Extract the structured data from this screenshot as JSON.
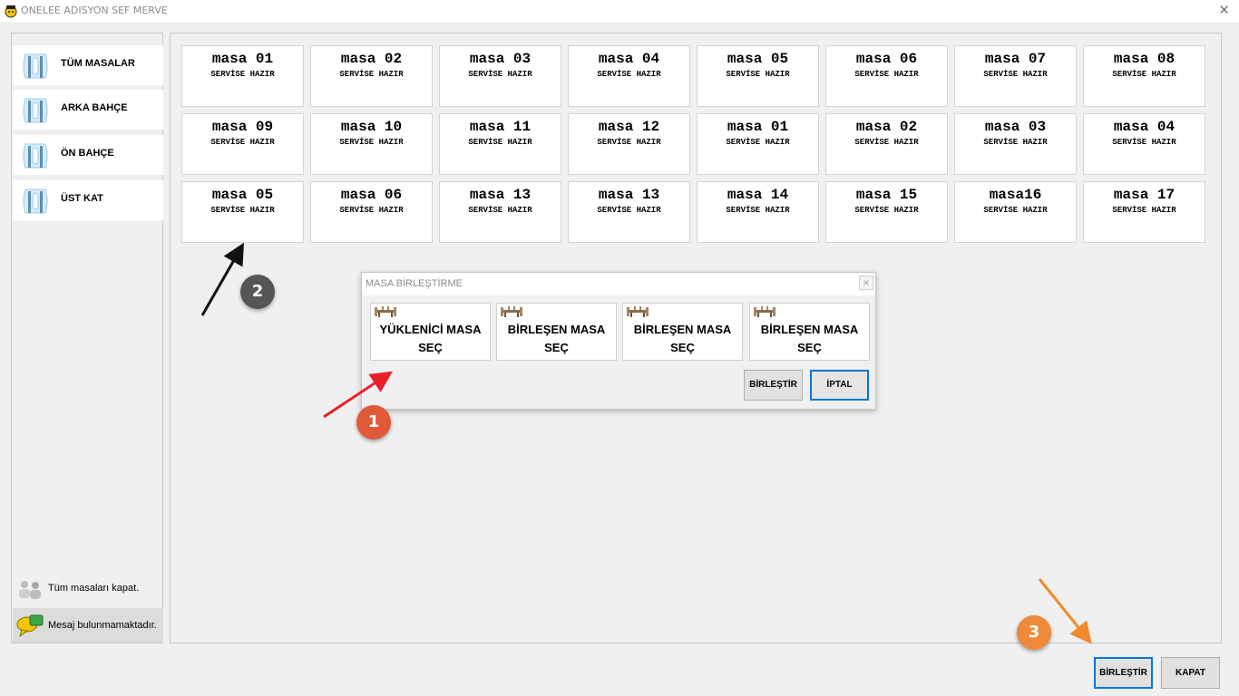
{
  "window": {
    "title": "ONELEE ADISYON SEF MERVE",
    "close_glyph": "✕"
  },
  "sidebar": {
    "items": [
      {
        "label": "TÜM MASALAR",
        "icon": "cutlery-icon"
      },
      {
        "label": "ARKA BAHÇE",
        "icon": "cutlery-icon"
      },
      {
        "label": "ÖN BAHÇE",
        "icon": "cutlery-icon"
      },
      {
        "label": "ÜST KAT",
        "icon": "cutlery-icon"
      }
    ],
    "close_all_label": "Tüm masaları kapat.",
    "message_label": "Mesaj bulunmamaktadır."
  },
  "tables": [
    {
      "name": "masa 01",
      "status": "SERVİSE HAZIR"
    },
    {
      "name": "masa 02",
      "status": "SERVİSE HAZIR"
    },
    {
      "name": "masa 03",
      "status": "SERVİSE HAZIR"
    },
    {
      "name": "masa 04",
      "status": "SERVİSE HAZIR"
    },
    {
      "name": "masa 05",
      "status": "SERVİSE HAZIR"
    },
    {
      "name": "masa 06",
      "status": "SERVİSE HAZIR"
    },
    {
      "name": "masa 07",
      "status": "SERVİSE HAZIR"
    },
    {
      "name": "masa 08",
      "status": "SERVİSE HAZIR"
    },
    {
      "name": "masa 09",
      "status": "SERVİSE HAZIR"
    },
    {
      "name": "masa 10",
      "status": "SERVİSE HAZIR"
    },
    {
      "name": "masa 11",
      "status": "SERVİSE HAZIR"
    },
    {
      "name": "masa 12",
      "status": "SERVİSE HAZIR"
    },
    {
      "name": "masa 01",
      "status": "SERVİSE HAZIR"
    },
    {
      "name": "masa 02",
      "status": "SERVİSE HAZIR"
    },
    {
      "name": "masa 03",
      "status": "SERVİSE HAZIR"
    },
    {
      "name": "masa 04",
      "status": "SERVİSE HAZIR"
    },
    {
      "name": "masa 05",
      "status": "SERVİSE HAZIR"
    },
    {
      "name": "masa 06",
      "status": "SERVİSE HAZIR"
    },
    {
      "name": "masa 13",
      "status": "SERVİSE HAZIR"
    },
    {
      "name": "masa 13",
      "status": "SERVİSE HAZIR"
    },
    {
      "name": "masa 14",
      "status": "SERVİSE HAZIR"
    },
    {
      "name": "masa 15",
      "status": "SERVİSE HAZIR"
    },
    {
      "name": "masa16",
      "status": "SERVİSE HAZIR"
    },
    {
      "name": "masa 17",
      "status": "SERVİSE HAZIR"
    }
  ],
  "dialog": {
    "title": "MASA BİRLEŞTİRME",
    "close_glyph": "×",
    "select_buttons": [
      {
        "label": "YÜKLENİCİ MASA SEÇ",
        "icon": "table-icon"
      },
      {
        "label": "BİRLEŞEN MASA SEÇ",
        "icon": "table-icon"
      },
      {
        "label": "BİRLEŞEN MASA SEÇ",
        "icon": "table-icon"
      },
      {
        "label": "BİRLEŞEN MASA SEÇ",
        "icon": "table-icon"
      }
    ],
    "merge_label": "BİRLEŞTİR",
    "cancel_label": "İPTAL"
  },
  "footer": {
    "merge_label": "BİRLEŞTİR",
    "close_label": "KAPAT"
  },
  "annotations": [
    {
      "number": "1",
      "color": "#e05a3a"
    },
    {
      "number": "2",
      "color": "#555555"
    },
    {
      "number": "3",
      "color": "#ef8a3a"
    }
  ],
  "colors": {
    "accent": "#0078d7",
    "arrow_red": "#e8202a",
    "arrow_black": "#111111",
    "arrow_orange": "#f08a2a"
  }
}
